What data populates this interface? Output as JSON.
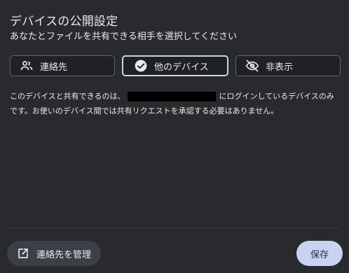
{
  "dialog": {
    "title": "デバイスの公開設定",
    "subtitle": "あなたとファイルを共有できる相手を選択してください"
  },
  "visibility_options": [
    {
      "label": "連絡先",
      "icon": "people-icon",
      "selected": false
    },
    {
      "label": "他のデバイス",
      "icon": "check-circle-icon",
      "selected": true
    },
    {
      "label": "非表示",
      "icon": "eye-off-icon",
      "selected": false
    }
  ],
  "description": {
    "before": "このデバイスと共有できるのは、",
    "after": "にログインしているデバイスのみです。お使いのデバイス間では共有リクエストを承認する必要はありません。"
  },
  "footer": {
    "manage_contacts_label": "連絡先を管理",
    "save_label": "保存"
  },
  "colors": {
    "background": "#292a2d",
    "accent": "#c8d3f2"
  }
}
